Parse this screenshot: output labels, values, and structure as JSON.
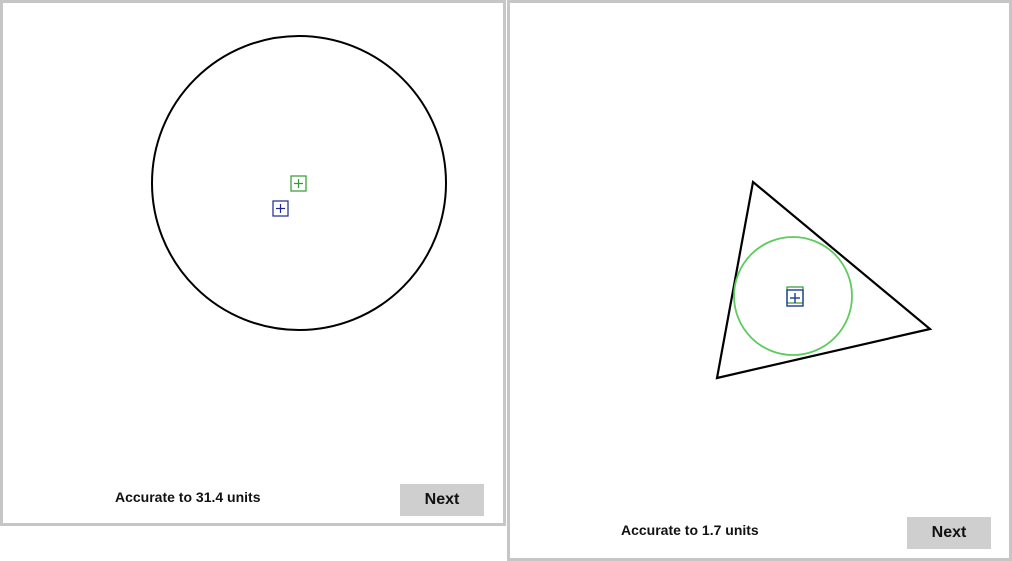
{
  "left_panel": {
    "shape": "circle",
    "status_text": "Accurate to 31.4 units",
    "next_label": "Next",
    "colors": {
      "shape_stroke": "#000000",
      "target_marker": "#2e9b2e",
      "guess_marker": "#1c2a8a"
    }
  },
  "right_panel": {
    "shape": "triangle",
    "status_text": "Accurate to 1.7 units",
    "next_label": "Next",
    "colors": {
      "shape_stroke": "#000000",
      "incircle": "#5ccc5c",
      "target_marker": "#2e9b2e",
      "guess_marker": "#1c3a9a"
    }
  },
  "icons": {
    "marker": "crosshair-square-icon"
  }
}
